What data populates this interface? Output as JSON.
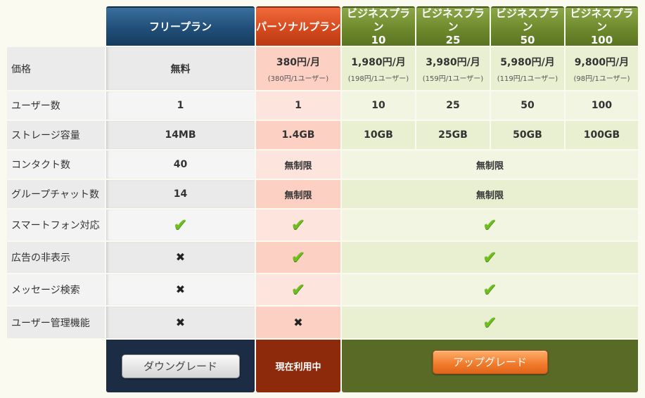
{
  "headers": {
    "free": "フリープラン",
    "personal": "パーソナルプラン",
    "b10": [
      "ビジネスプラン",
      "10"
    ],
    "b25": [
      "ビジネスプラン",
      "25"
    ],
    "b50": [
      "ビジネスプラン",
      "50"
    ],
    "b100": [
      "ビジネスプラン",
      "100"
    ]
  },
  "rows": {
    "price": {
      "label": "価格",
      "free": "無料",
      "personal": [
        "380円/月",
        "(380円/1ユーザー)"
      ],
      "b10": [
        "1,980円/月",
        "(198円/1ユーザー)"
      ],
      "b25": [
        "3,980円/月",
        "(159円/1ユーザー)"
      ],
      "b50": [
        "5,980円/月",
        "(119円/1ユーザー)"
      ],
      "b100": [
        "9,800円/月",
        "(98円/1ユーザー)"
      ]
    },
    "users": {
      "label": "ユーザー数",
      "free": "1",
      "personal": "1",
      "b10": "10",
      "b25": "25",
      "b50": "50",
      "b100": "100"
    },
    "storage": {
      "label": "ストレージ容量",
      "free": "14MB",
      "personal": "1.4GB",
      "b10": "10GB",
      "b25": "25GB",
      "b50": "50GB",
      "b100": "100GB"
    },
    "contacts": {
      "label": "コンタクト数",
      "free": "40",
      "personal": "無制限",
      "business": "無制限"
    },
    "group_chat": {
      "label": "グループチャット数",
      "free": "14",
      "personal": "無制限",
      "business": "無制限"
    },
    "smartphone": {
      "label": "スマートフォン対応",
      "free": "check",
      "personal": "check",
      "business": "check"
    },
    "hide_ads": {
      "label": "広告の非表示",
      "free": "cross",
      "personal": "check",
      "business": "check"
    },
    "message_search": {
      "label": "メッセージ検索",
      "free": "cross",
      "personal": "check",
      "business": "check"
    },
    "user_admin": {
      "label": "ユーザー管理機能",
      "free": "cross",
      "personal": "cross",
      "business": "check"
    }
  },
  "footer": {
    "downgrade_label": "ダウングレード",
    "current_label": "現在利用中",
    "upgrade_label": "アップグレード"
  },
  "icons": {
    "check": "✔",
    "cross": "✖"
  },
  "colors": {
    "free_header": "#214e78",
    "personal_header": "#d54a1e",
    "business_header": "#6e8a2d"
  }
}
